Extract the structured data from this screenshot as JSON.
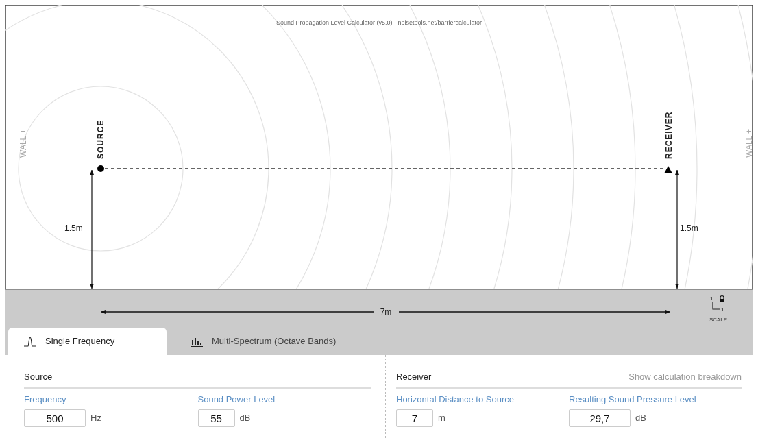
{
  "title": "Sound Propagation Level Calculator (v5.0) - noisetools.net/barriercalculator",
  "walls": [
    "WALL +",
    "WALL +"
  ],
  "source": {
    "label": "SOURCE",
    "height": "1.5m"
  },
  "receiver": {
    "label": "RECEIVER",
    "height": "1.5m"
  },
  "distance": "7m",
  "scale": {
    "y_unit": "1",
    "x_unit": "1",
    "label": "SCALE",
    "locked": true
  },
  "tabs": [
    {
      "label": "Single Frequency",
      "kind": "pulse",
      "selected": true
    },
    {
      "label": "Multi-Spectrum (Octave Bands)",
      "kind": "bars",
      "selected": false
    }
  ],
  "sections": [
    {
      "title": "Source",
      "fields": [
        {
          "label": "Frequency",
          "value": "500",
          "unit": "Hz"
        },
        {
          "label": "Sound Power Level",
          "value": "55",
          "unit": "dB"
        }
      ]
    },
    {
      "title": "Receiver",
      "link": "Show calculation breakdown",
      "fields": [
        {
          "label": "Horizontal Distance to Source",
          "value": "7",
          "unit": "m"
        },
        {
          "label": "Resulting Sound Pressure Level",
          "value": "29,7",
          "unit": "dB"
        }
      ]
    }
  ]
}
